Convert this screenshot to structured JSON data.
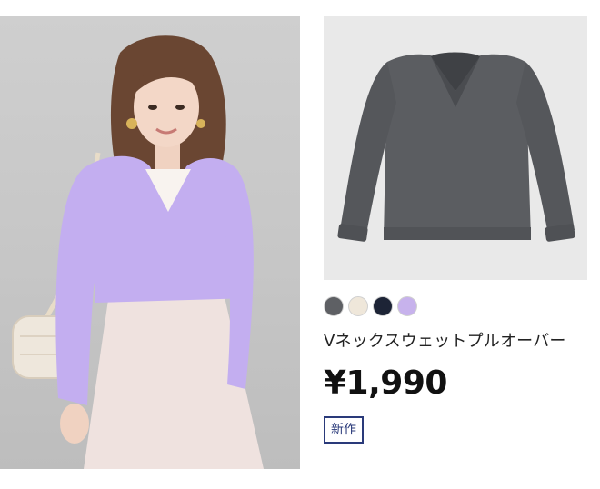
{
  "product": {
    "name": "Vネックスウェットプルオーバー",
    "price": "¥1,990",
    "badge": "新作",
    "model_photo_icon": "model-photo",
    "product_photo_icon": "sweater-photo",
    "swatches": [
      {
        "name": "dark-gray",
        "color": "#5e6064"
      },
      {
        "name": "off-white",
        "color": "#efe7da"
      },
      {
        "name": "navy",
        "color": "#1d2436"
      },
      {
        "name": "lavender",
        "color": "#c7b2ec"
      }
    ],
    "colors": {
      "sweater_gray": "#5b5d61",
      "sweater_purple": "#c3aef0",
      "skirt_pink": "#efe1df",
      "badge_navy": "#2a3a7a"
    }
  }
}
